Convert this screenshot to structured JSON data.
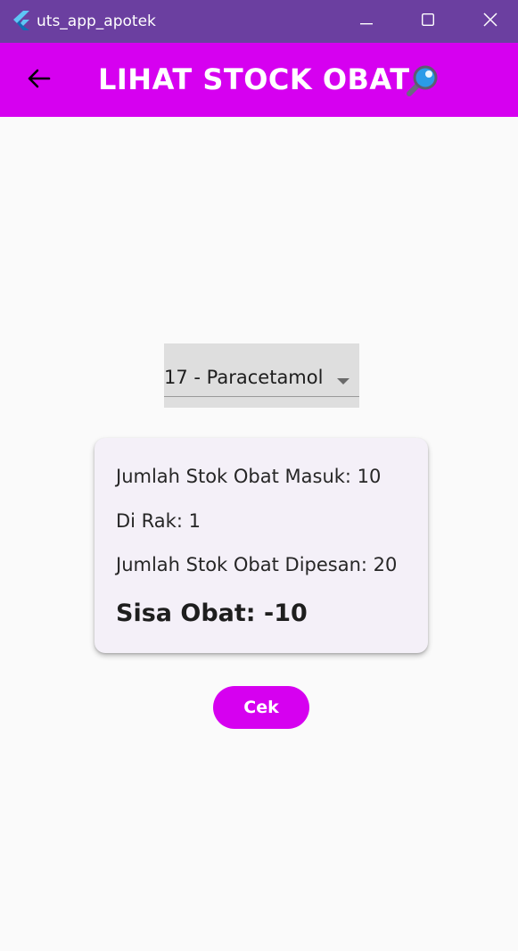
{
  "window": {
    "title": "uts_app_apotek",
    "icon": "flutter-icon",
    "controls": [
      "minimize-icon",
      "maximize-icon",
      "close-icon"
    ]
  },
  "appbar": {
    "title": "LIHAT STOCK OBAT",
    "back_icon": "back-arrow-icon",
    "emoji_icon": "magnifier-icon",
    "background": "#d600f0"
  },
  "dropdown": {
    "selected": "17 - Paracetamol",
    "icon": "dropdown-arrow-icon"
  },
  "card": {
    "stok_masuk": "Jumlah Stok Obat Masuk: 10",
    "di_rak": "Di Rak: 1",
    "stok_dipesan": "Jumlah Stok Obat Dipesan: 20",
    "sisa": "Sisa Obat: -10"
  },
  "button": {
    "label": "Cek",
    "color": "#d600f0"
  },
  "colors": {
    "titlebar": "#6b3fa0",
    "background": "#fafafa",
    "card": "#f4f0f8"
  }
}
